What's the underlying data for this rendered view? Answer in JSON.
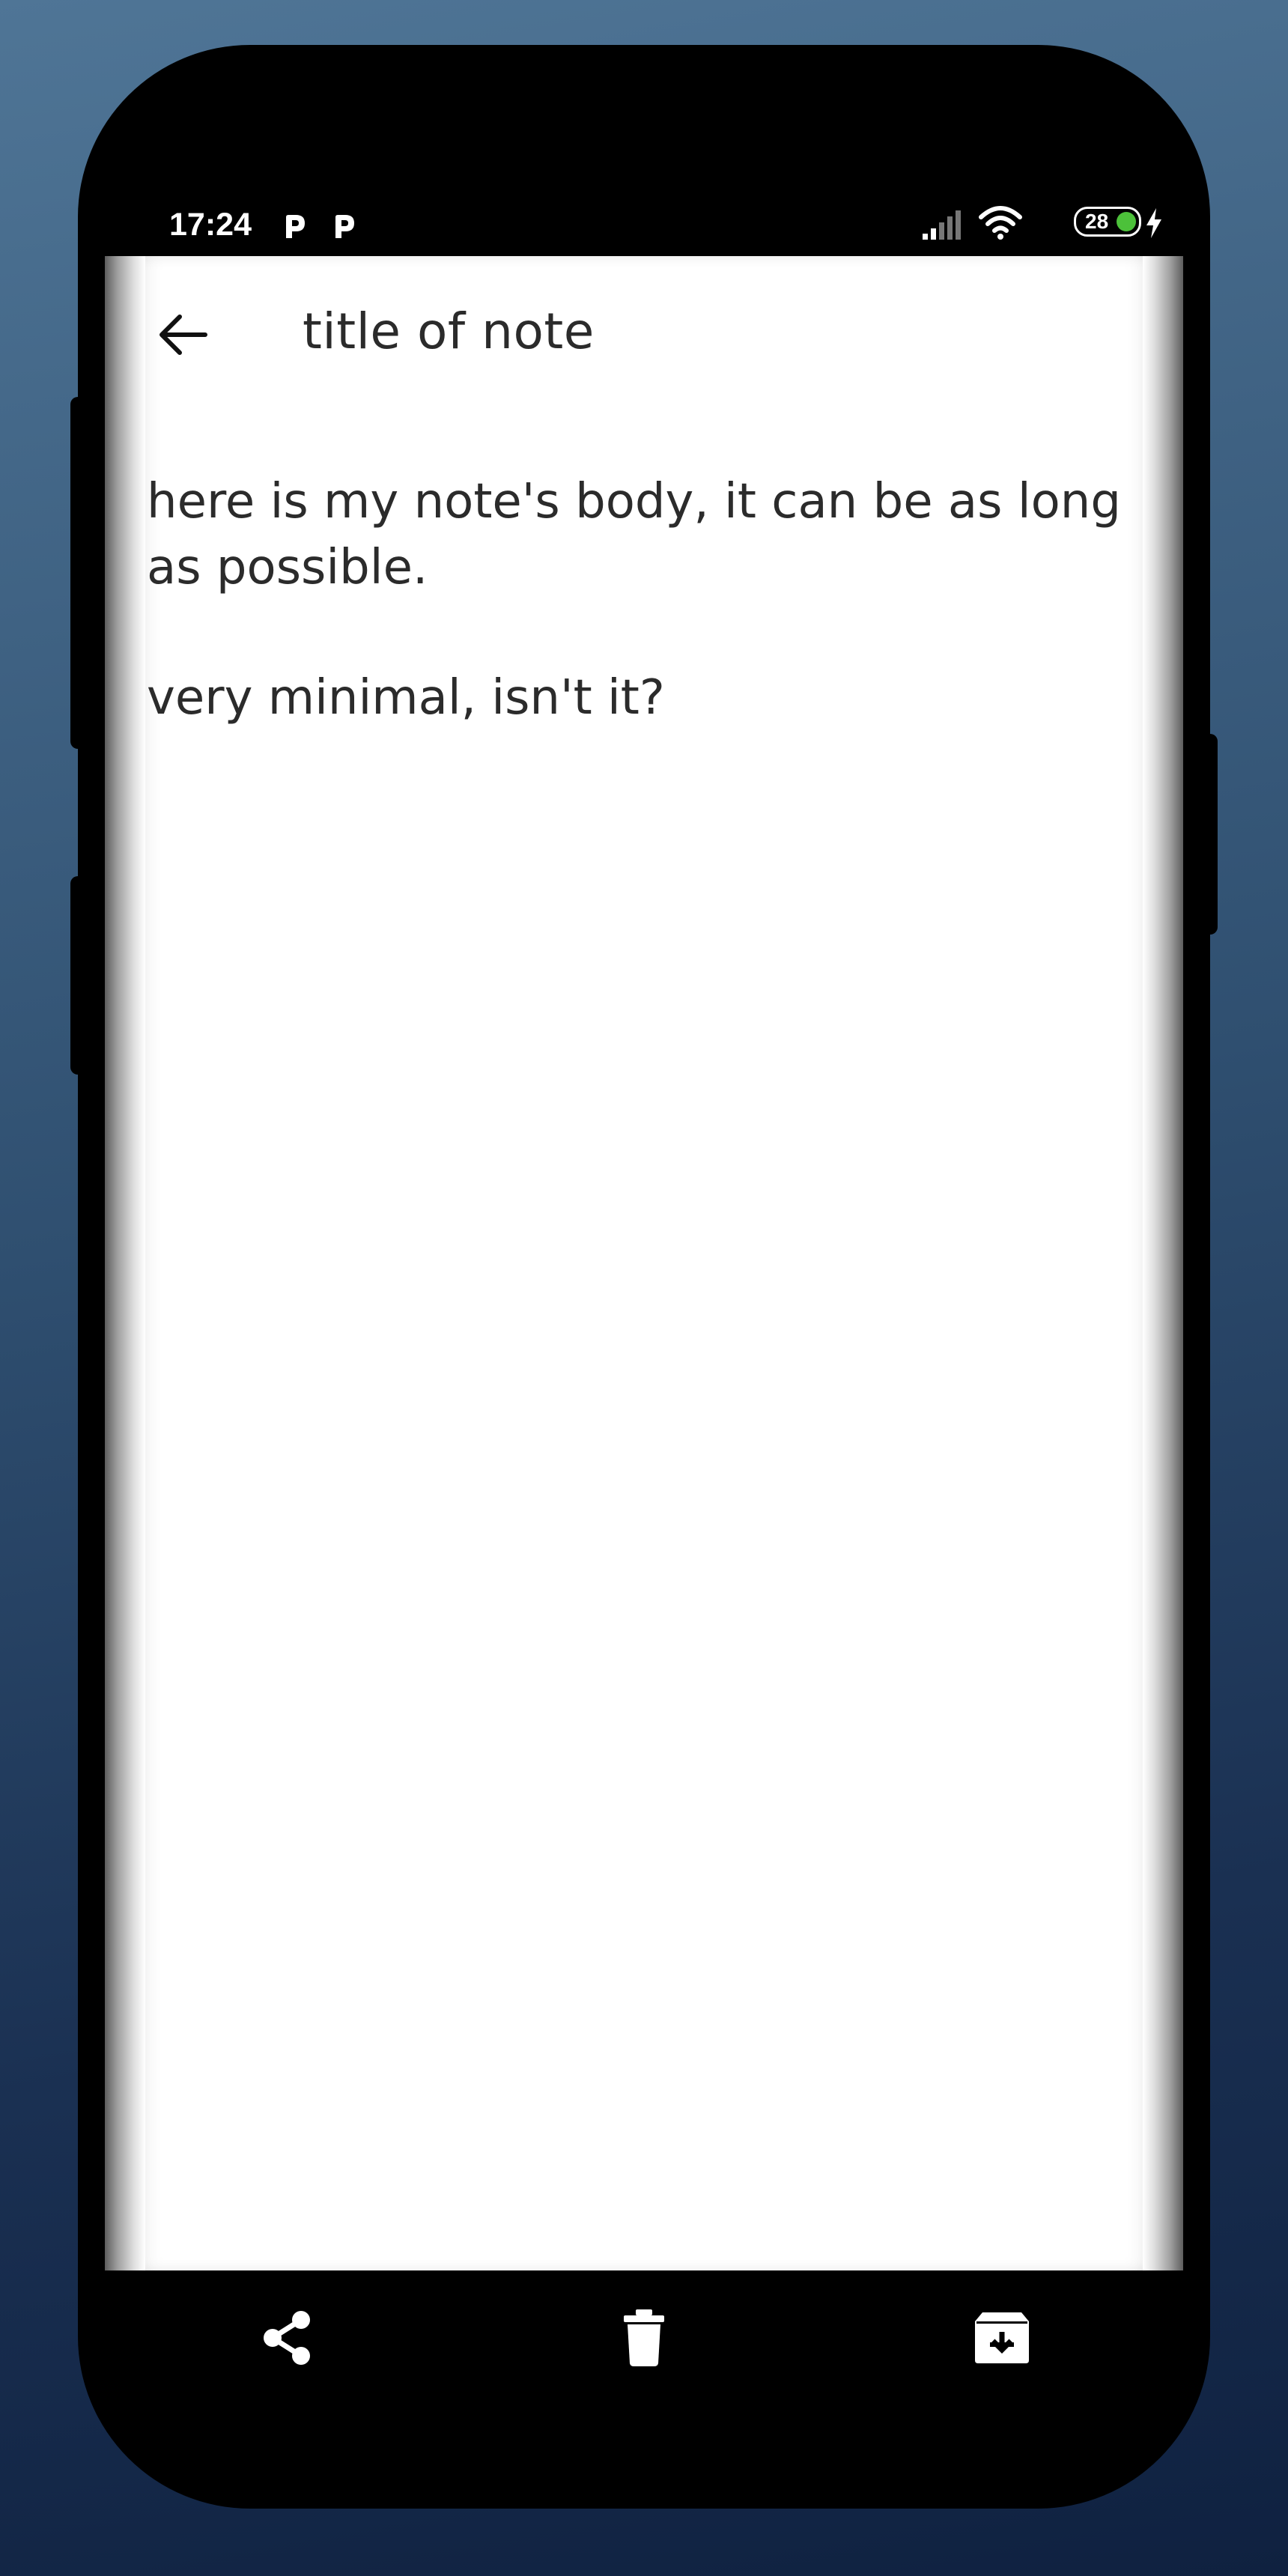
{
  "status_bar": {
    "time": "17:24",
    "notification_icons": [
      "parking-app-icon",
      "parking-app-icon"
    ],
    "signal_icon": "cell-signal-icon",
    "wifi_icon": "wifi-icon",
    "battery_level": "28",
    "charging_icon": "charging-bolt-icon",
    "battery_accent": "#4cc13a"
  },
  "app_bar": {
    "back_icon": "arrow-back-icon",
    "title": "title of note"
  },
  "note": {
    "body_lines": [
      "here is my note's body, it can be as long as possible.",
      "very minimal, isn't it?"
    ]
  },
  "bottom_actions": [
    {
      "name": "share",
      "icon": "share-icon"
    },
    {
      "name": "delete",
      "icon": "trash-icon"
    },
    {
      "name": "archive",
      "icon": "archive-icon"
    }
  ],
  "colors": {
    "background_top": "#4f7596",
    "background_bottom": "#0f2140",
    "phone_frame": "#000000",
    "screen": "#ffffff",
    "text": "#2b2b2b"
  }
}
